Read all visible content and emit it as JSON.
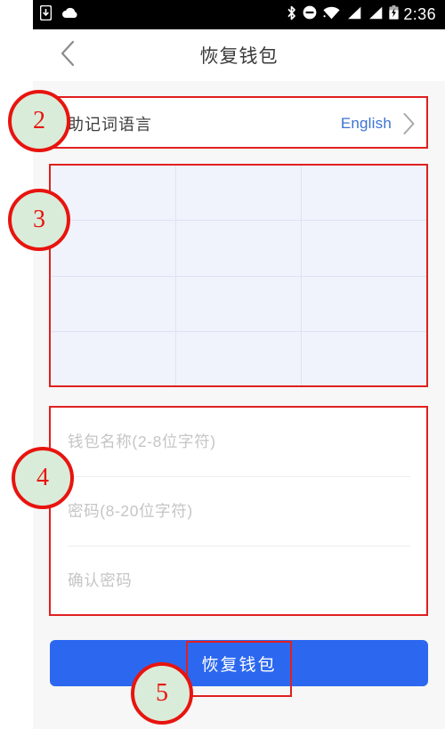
{
  "status_bar": {
    "time": "2:36",
    "left_icons": [
      "sd-card-download-icon",
      "cloud-icon"
    ],
    "right_icons": [
      "bluetooth-icon",
      "do-not-disturb-icon",
      "wifi-icon",
      "signal-sim1-icon",
      "signal-sim2-icon",
      "battery-charging-icon"
    ]
  },
  "title_bar": {
    "back_icon": "chevron-left-icon",
    "title": "恢复钱包"
  },
  "language_row": {
    "label": "助记词语言",
    "value": "English",
    "chevron_icon": "chevron-right-icon"
  },
  "mnemonic_grid": {
    "columns": 3,
    "rows": 4,
    "cells": [
      "",
      "",
      "",
      "",
      "",
      "",
      "",
      "",
      "",
      "",
      "",
      ""
    ]
  },
  "form": {
    "fields": [
      {
        "name": "wallet-name",
        "value": "",
        "placeholder": "钱包名称(2-8位字符)",
        "type": "text"
      },
      {
        "name": "password",
        "value": "",
        "placeholder": "密码(8-20位字符)",
        "type": "password"
      },
      {
        "name": "confirm-password",
        "value": "",
        "placeholder": "确认密码",
        "type": "password"
      }
    ]
  },
  "submit": {
    "label": "恢复钱包"
  },
  "annotations": {
    "markers": [
      {
        "number": "2",
        "target": "language-row"
      },
      {
        "number": "3",
        "target": "mnemonic-grid"
      },
      {
        "number": "4",
        "target": "form-fields"
      },
      {
        "number": "5",
        "target": "submit-button"
      }
    ]
  },
  "colors": {
    "accent_blue": "#2c68ef",
    "link_blue": "#3b72d4",
    "annotation_red": "#e8140f",
    "annotation_fill": "#d9ecd9",
    "grid_bg": "#f0f3fc",
    "page_bg": "#f7f7f7"
  }
}
